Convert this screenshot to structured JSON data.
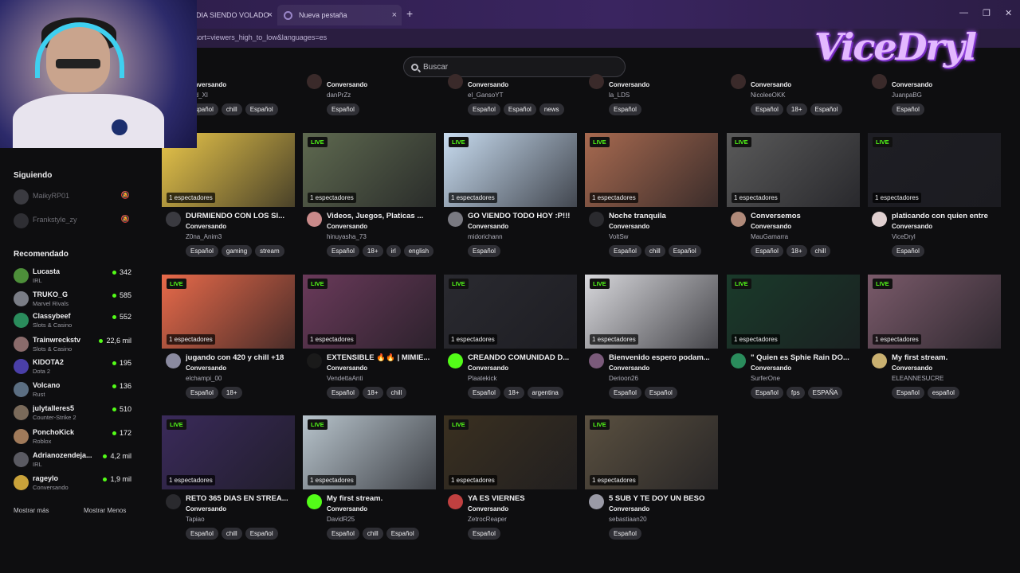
{
  "browser": {
    "tabs": [
      {
        "label": "DIA SIENDO VOLADO",
        "close": "×"
      },
      {
        "label": "Nueva pestaña",
        "close": "×"
      }
    ],
    "new_tab": "+",
    "window_controls": [
      "—",
      "❐",
      "✕"
    ],
    "url": "sort=viewers_high_to_low&languages=es"
  },
  "overlay": {
    "logo_text": "ViceDryl"
  },
  "search": {
    "placeholder": "Buscar"
  },
  "sidebar": {
    "following_heading": "Siguiendo",
    "following": [
      {
        "name": "MaikyRP01",
        "bell": "🔕",
        "avatar_color": "#3a3a40"
      },
      {
        "name": "Frankstyle_zy",
        "bell": "🔕",
        "avatar_color": "#2e2e33"
      }
    ],
    "recommended_heading": "Recomendado",
    "recommended": [
      {
        "name": "Lucasta",
        "category": "IRL",
        "viewers": "342",
        "avatar_color": "#4d8f3a"
      },
      {
        "name": "TRUKO_G",
        "category": "Marvel Rivals",
        "viewers": "585",
        "avatar_color": "#7a7d86"
      },
      {
        "name": "Classybeef",
        "category": "Slots & Casino",
        "viewers": "552",
        "avatar_color": "#2a8c5c"
      },
      {
        "name": "Trainwreckstv",
        "category": "Slots & Casino",
        "viewers": "22,6 mil",
        "avatar_color": "#8a6b6b"
      },
      {
        "name": "KIDOTA2",
        "category": "Dota 2",
        "viewers": "195",
        "avatar_color": "#4a3fa8"
      },
      {
        "name": "Volcano",
        "category": "Rust",
        "viewers": "136",
        "avatar_color": "#5b6e82"
      },
      {
        "name": "julytalleres5",
        "category": "Counter-Strike 2",
        "viewers": "510",
        "avatar_color": "#7a6a5a"
      },
      {
        "name": "PonchoKick",
        "category": "Roblox",
        "viewers": "172",
        "avatar_color": "#a07a5a"
      },
      {
        "name": "Adrianozendeja...",
        "category": "IRL",
        "viewers": "4,2 mil",
        "avatar_color": "#5a5a62"
      },
      {
        "name": "rageylo",
        "category": "Conversando",
        "viewers": "1,9 mil",
        "avatar_color": "#c9a23a"
      }
    ],
    "show_more": "Mostrar más",
    "show_less": "Mostrar Menos"
  },
  "top_row": [
    {
      "category": "Conversando",
      "user": "hard_XI",
      "tags": [
        "Español",
        "chill",
        "Español"
      ]
    },
    {
      "category": "Conversando",
      "user": "danPrZz",
      "tags": [
        "Español"
      ]
    },
    {
      "category": "Conversando",
      "user": "el_GansoYT",
      "tags": [
        "Español",
        "Español",
        "news"
      ]
    },
    {
      "category": "Conversando",
      "user": "la_LDS",
      "tags": [
        "Español"
      ]
    },
    {
      "category": "Conversando",
      "user": "NicoleeOKK",
      "tags": [
        "Español",
        "18+",
        "Español"
      ]
    },
    {
      "category": "Conversando",
      "user": "JuanpaBG",
      "tags": [
        "Español"
      ]
    }
  ],
  "streams": [
    {
      "live": "",
      "viewers": "1 espectadores",
      "title": "DURMIENDO CON LOS SI...",
      "category": "Conversando",
      "user": "Z0na_Anim3",
      "tags": [
        "Español",
        "gaming",
        "stream"
      ],
      "thumb": "#e9c64a",
      "avatar": "#3a3a40"
    },
    {
      "live": "LIVE",
      "viewers": "1 espectadores",
      "title": "Videos, Juegos, Platicas ...",
      "category": "Conversando",
      "user": "hinuyasha_73",
      "tags": [
        "Español",
        "18+",
        "irl",
        "english"
      ],
      "thumb": "#5f6a50",
      "avatar": "#c98a8a"
    },
    {
      "live": "LIVE",
      "viewers": "1 espectadores",
      "title": "GO VIENDO TODO HOY :P!!!",
      "category": "Conversando",
      "user": "midorichann",
      "tags": [
        "Español"
      ],
      "thumb": "#c8dcf0",
      "avatar": "#7a7a82"
    },
    {
      "live": "LIVE",
      "viewers": "1 espectadores",
      "title": "Noche tranquila",
      "category": "Conversando",
      "user": "VoltSw",
      "tags": [
        "Español",
        "chill",
        "Español"
      ],
      "thumb": "#a86a50",
      "avatar": "#2a2a2e"
    },
    {
      "live": "LIVE",
      "viewers": "1 espectadores",
      "title": "Conversemos",
      "category": "Conversando",
      "user": "MauGamarra",
      "tags": [
        "Español",
        "18+",
        "chill"
      ],
      "thumb": "#5a5a5a",
      "avatar": "#b08a7a"
    },
    {
      "live": "LIVE",
      "viewers": "1 espectadores",
      "title": "platicando con quien entre",
      "category": "Conversando",
      "user": "ViceDryl",
      "tags": [
        "Español"
      ],
      "thumb": "#1e1e24",
      "avatar": "#e0d0d0"
    },
    {
      "live": "LIVE",
      "viewers": "1 espectadores",
      "title": "jugando con 420 y chill +18",
      "category": "Conversando",
      "user": "elchampi_00",
      "tags": [
        "Español",
        "18+"
      ],
      "thumb": "#e86a4a",
      "avatar": "#8a8aa0"
    },
    {
      "live": "LIVE",
      "viewers": "1 espectadores",
      "title": "EXTENSIBLE 🔥🔥 | MIMIE...",
      "category": "Conversando",
      "user": "VendettaAnti",
      "tags": [
        "Español",
        "18+",
        "chill"
      ],
      "thumb": "#6a3a5a",
      "avatar": "#1a1a1a"
    },
    {
      "live": "LIVE",
      "viewers": "1 espectadores",
      "title": "CREANDO COMUNIDAD D...",
      "category": "Conversando",
      "user": "Plaatekick",
      "tags": [
        "Español",
        "18+",
        "argentina"
      ],
      "thumb": "#2a2a30",
      "avatar": "#53fc18"
    },
    {
      "live": "LIVE",
      "viewers": "1 espectadores",
      "title": "Bienvenido espero podam...",
      "category": "Conversando",
      "user": "Derioon26",
      "tags": [
        "Español",
        "Español"
      ],
      "thumb": "#d8d8dc",
      "avatar": "#7a5a7a"
    },
    {
      "live": "LIVE",
      "viewers": "1 espectadores",
      "title": "\" Quien es Sphie Rain DO...",
      "category": "Conversando",
      "user": "SurferOne",
      "tags": [
        "Español",
        "fps",
        "ESPAÑA"
      ],
      "thumb": "#1a3a2a",
      "avatar": "#2a8c5c"
    },
    {
      "live": "LIVE",
      "viewers": "1 espectadores",
      "title": "My first stream.",
      "category": "Conversando",
      "user": "ELEANNESUCRE",
      "tags": [
        "Español",
        "español"
      ],
      "thumb": "#7a5a6a",
      "avatar": "#c9b070"
    },
    {
      "live": "LIVE",
      "viewers": "1 espectadores",
      "title": "RETO 365 DIAS EN STREA...",
      "category": "Conversando",
      "user": "Tapiao",
      "tags": [
        "Español",
        "chill",
        "Español"
      ],
      "thumb": "#3a2a5a",
      "avatar": "#2a2a2e"
    },
    {
      "live": "LIVE",
      "viewers": "1 espectadores",
      "title": "My first stream.",
      "category": "Conversando",
      "user": "DavidR25",
      "tags": [
        "Español",
        "chill",
        "Español"
      ],
      "thumb": "#b8c4cc",
      "avatar": "#53fc18"
    },
    {
      "live": "LIVE",
      "viewers": "1 espectadores",
      "title": "YA ES VIERNES",
      "category": "Conversando",
      "user": "ZetrocReaper",
      "tags": [
        "Español"
      ],
      "thumb": "#3a3020",
      "avatar": "#c04040"
    },
    {
      "live": "LIVE",
      "viewers": "1 espectadores",
      "title": "5 SUB Y TE DOY UN BESO",
      "category": "Conversando",
      "user": "sebastiaan20",
      "tags": [
        "Español"
      ],
      "thumb": "#5a5040",
      "avatar": "#9a9aa6"
    }
  ],
  "colors": {
    "accent": "#53fc18",
    "background": "#0e0e10",
    "tag_bg": "#2f2f35"
  }
}
